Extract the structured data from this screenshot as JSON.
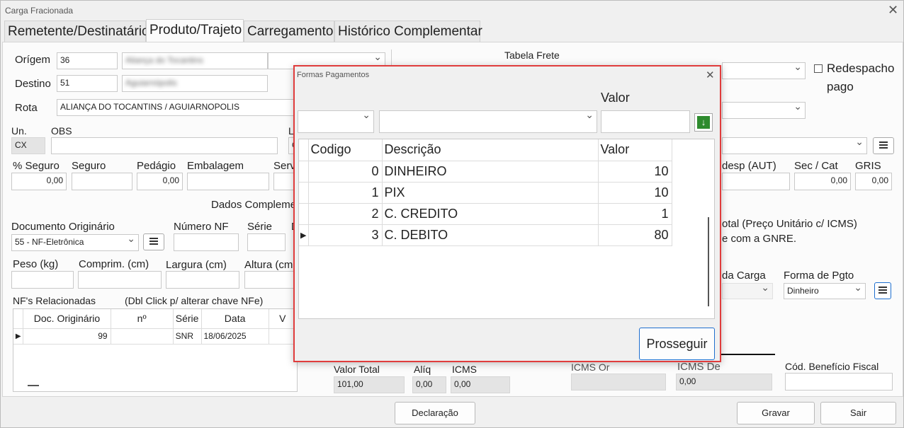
{
  "window": {
    "title": "Carga Fracionada"
  },
  "tabs": [
    {
      "label": "Remetente/Destinatário"
    },
    {
      "label": "Produto/Trajeto"
    },
    {
      "label": "Carregamento"
    },
    {
      "label": "Histórico Complementar"
    }
  ],
  "form": {
    "origem_label": "Orígem",
    "origem_code": "36",
    "origem_name": "Aliança do Tocantins",
    "destino_label": "Destino",
    "destino_code": "51",
    "destino_name": "Aguiarnópolis",
    "rota_label": "Rota",
    "rota_value": "ALIANÇA DO TOCANTINS / AGUIARNOPOLIS",
    "tabela_frete_label": "Tabela Frete",
    "redespacho_label_1": "Redespacho",
    "redespacho_label_2": "pago",
    "un_label": "Un.",
    "un_value": "CX",
    "obs_label": "OBS",
    "l_label": "L",
    "l_value": "C",
    "pct_seguro_label": "% Seguro",
    "pct_seguro_value": "0,00",
    "seguro_label": "Seguro",
    "pedagio_label": "Pedágio",
    "pedagio_value": "0,00",
    "embalagem_label": "Embalagem",
    "serv_label": "Serv",
    "desp_label": "desp (AUT)",
    "sec_cat_label": "Sec / Cat",
    "sec_cat_value": "0,00",
    "gris_label": "GRIS",
    "gris_value": "0,00",
    "dados_comple_label": "Dados Compleme",
    "doc_orig_label": "Documento Originário",
    "doc_orig_value": "55 - NF-Eletrônica",
    "numero_nf_label": "Número NF",
    "serie_label": "Série",
    "d_label": "D",
    "total_note_1": "otal (Preço Unitário c/ ICMS)",
    "total_note_2": "e com a GNRE.",
    "peso_label": "Peso (kg)",
    "comprim_label": "Comprim. (cm)",
    "largura_label": "Largura (cm)",
    "altura_label": "Altura (cm",
    "da_carga_label": "da Carga",
    "forma_pgto_label": "Forma de Pgto",
    "forma_pgto_value": "Dinheiro",
    "nfs_label": "NF's Relacionadas",
    "nfs_hint": "(Dbl Click p/ alterar chave NFe)",
    "nfs_headers": [
      "Doc. Originário",
      "nº",
      "Série",
      "Data",
      "V"
    ],
    "nfs_rows": [
      {
        "doc": "99",
        "n": "",
        "serie": "SNR",
        "data": "18/06/2025",
        "v": ""
      }
    ],
    "valor_total_label": "Valor Total",
    "valor_total_value": "101,00",
    "aliq_label": "Alíq",
    "aliq_value": "0,00",
    "icms_label": "ICMS",
    "icms_value": "0,00",
    "icms_or_label": "ICMS Or",
    "icms_de_label": "ICMS De",
    "icms_de_value": "0,00",
    "cod_beneficio_label": "Cód. Benefício Fiscal"
  },
  "buttons": {
    "declaracao": "Declaração",
    "gravar": "Gravar",
    "sair": "Sair"
  },
  "dialog": {
    "title": "Formas Pagamentos",
    "valor_label": "Valor",
    "grid_headers": [
      "Codigo",
      "Descrição",
      "Valor"
    ],
    "rows": [
      {
        "codigo": "0",
        "descricao": "DINHEIRO",
        "valor": "10"
      },
      {
        "codigo": "1",
        "descricao": "PIX",
        "valor": "10"
      },
      {
        "codigo": "2",
        "descricao": "C. CREDITO",
        "valor": "1"
      },
      {
        "codigo": "3",
        "descricao": "C. DEBITO",
        "valor": "80"
      }
    ],
    "prosseguir_label": "Prosseguir"
  },
  "colors": {
    "dialog_border": "#e03c3c",
    "add_icon_bg": "#2e8b2e",
    "accent_blue": "#1f6fcf"
  }
}
